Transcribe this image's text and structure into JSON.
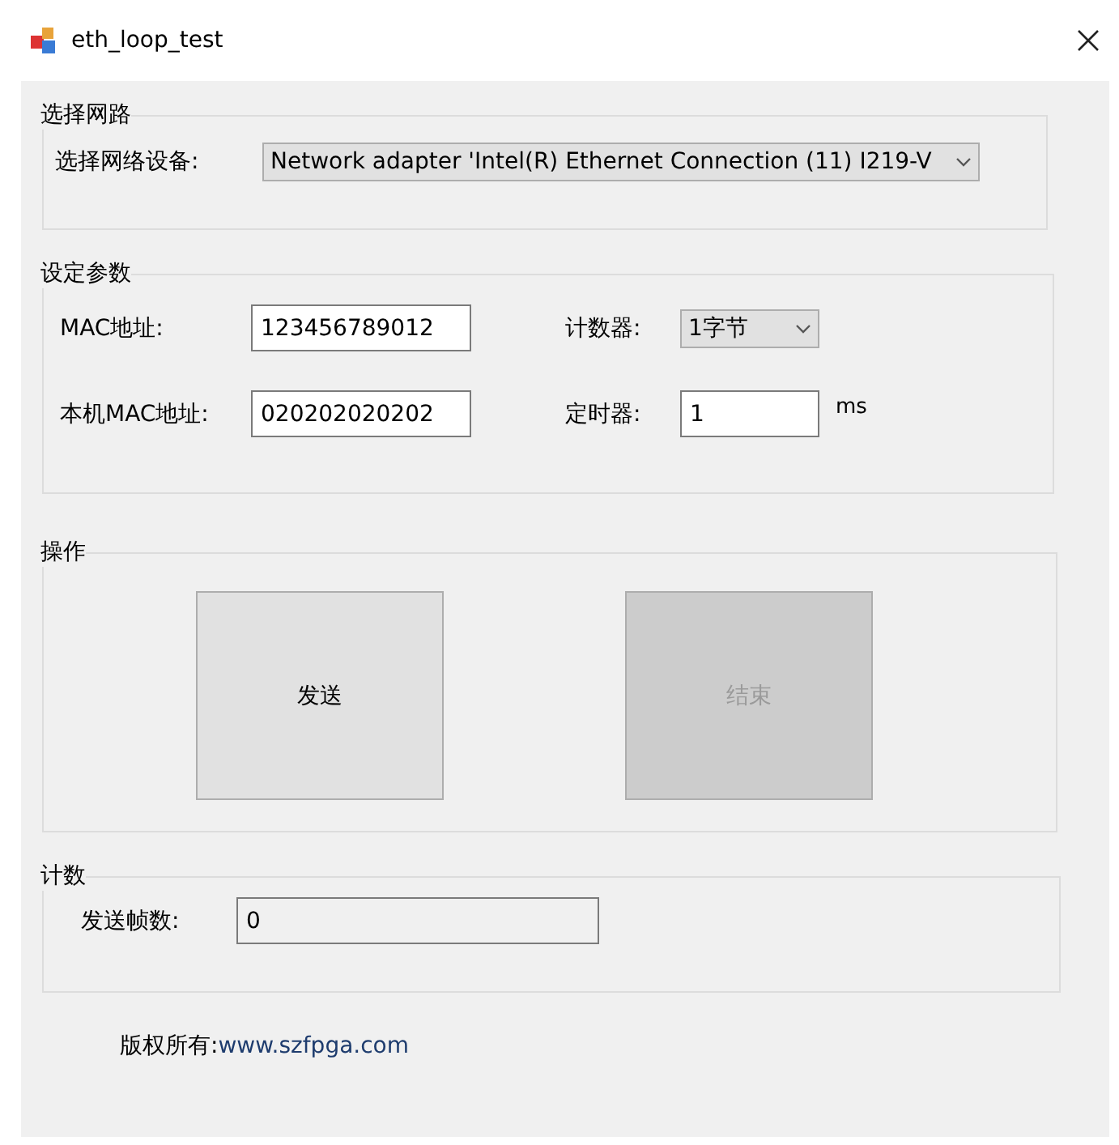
{
  "window": {
    "title": "eth_loop_test"
  },
  "network_group": {
    "title": "选择网路",
    "device_label": "选择网络设备:",
    "device_value": "Network adapter 'Intel(R) Ethernet Connection (11) I219-V"
  },
  "params_group": {
    "title": "设定参数",
    "fields": [
      {
        "label": "MAC地址:",
        "value": "123456789012",
        "kind": "text"
      },
      {
        "label": "计数器:",
        "value": "1字节",
        "kind": "select"
      },
      {
        "label": "本机MAC地址:",
        "value": "020202020202",
        "kind": "text"
      },
      {
        "label": "定时器:",
        "value": "1",
        "kind": "text",
        "unit": "ms"
      }
    ]
  },
  "actions_group": {
    "title": "操作",
    "buttons": [
      {
        "label": "发送",
        "disabled": false
      },
      {
        "label": "结束",
        "disabled": true
      }
    ]
  },
  "count_group": {
    "title": "计数",
    "label": "发送帧数:",
    "value": "0"
  },
  "copyright": {
    "label": "版权所有:",
    "link": "www.szfpga.com"
  }
}
